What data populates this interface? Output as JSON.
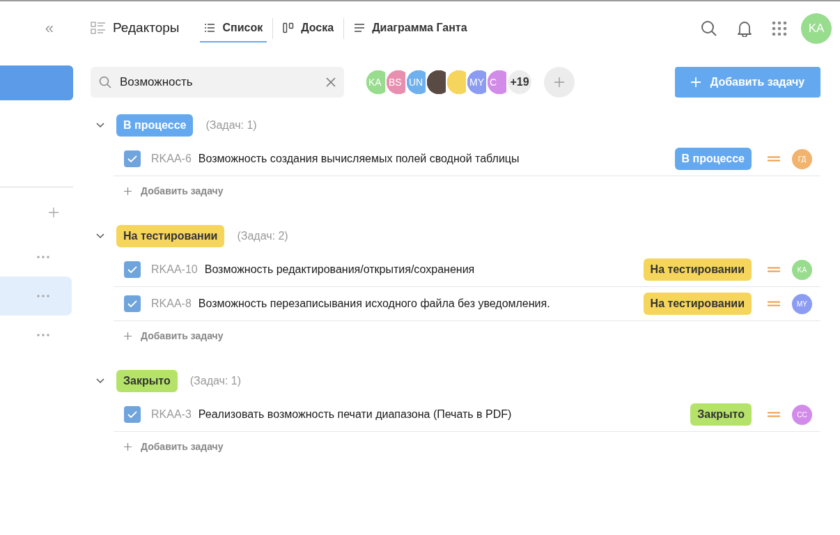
{
  "sidebar": {
    "collapse_glyph": "«",
    "items": [
      {
        "kind": "block",
        "selected": true
      },
      {
        "kind": "plus"
      },
      {
        "kind": "dots",
        "selected": false
      },
      {
        "kind": "dots",
        "selected": true
      },
      {
        "kind": "dots",
        "selected": false
      }
    ]
  },
  "tabs": [
    {
      "label": "Редакторы",
      "selected": false
    },
    {
      "label": "Список",
      "selected": true
    },
    {
      "label": "Доска",
      "selected": false
    },
    {
      "label": "Диаграмма Ганта",
      "selected": false
    }
  ],
  "user": {
    "initials": "KA",
    "color": "#98dc8e"
  },
  "search": {
    "value": "Возможность"
  },
  "members": [
    {
      "initials": "KA",
      "color": "#98dc8e",
      "kind": "initials"
    },
    {
      "initials": "BS",
      "color": "#e88fb0",
      "kind": "initials"
    },
    {
      "initials": "UN",
      "color": "#6fb0ee",
      "kind": "initials"
    },
    {
      "kind": "photo",
      "color": "#5a4a44"
    },
    {
      "color": "#f6d55c",
      "kind": "initials"
    },
    {
      "initials": "MY",
      "color": "#8b9cf2",
      "kind": "initials"
    },
    {
      "initials": "C",
      "color": "#d28be8",
      "kind": "initials"
    },
    {
      "kind": "more",
      "initials": "+19",
      "color": "#ececec"
    }
  ],
  "add_task_button": "Добавить задачу",
  "groups": [
    {
      "status": "В процессе",
      "color": "#64a9ef",
      "count": "(Задач: 1)",
      "expanded": true,
      "add_label": "Добавить задачу",
      "tasks": [
        {
          "id": "RKAA-6",
          "title": "Возможность создания вычисляемых полей сводной таблицы",
          "checked": true,
          "status": {
            "label": "В процессе",
            "color": "#64a9ef"
          },
          "assignee": {
            "initials": "ГД",
            "color": "#f2b36c"
          }
        }
      ]
    },
    {
      "status": "На тестировании",
      "color": "#f6d55c",
      "count": "(Задач: 2)",
      "expanded": true,
      "add_label": "Добавить задачу",
      "tasks": [
        {
          "id": "RKAA-10",
          "title": "Возможность редактирования/открытия/сохранения",
          "checked": true,
          "status": {
            "label": "На тестировании",
            "color": "#f6d55c"
          },
          "assignee": {
            "initials": "KA",
            "color": "#98dc8e"
          }
        },
        {
          "id": "RKAA-8",
          "title": "Возможность перезаписывания исходного файла без уведомления.",
          "checked": true,
          "status": {
            "label": "На тестировании",
            "color": "#f6d55c"
          },
          "assignee": {
            "initials": "MY",
            "color": "#8b9cf2"
          }
        }
      ]
    },
    {
      "status": "Закрыто",
      "color": "#b5e36a",
      "count": "(Задач: 1)",
      "expanded": true,
      "add_label": "Добавить задачу",
      "tasks": [
        {
          "id": "RKAA-3",
          "title": "Реализовать возможность печати диапазона (Печать в PDF)",
          "checked": true,
          "status": {
            "label": "Закрыто",
            "color": "#b5e36a"
          },
          "assignee": {
            "initials": "CC",
            "color": "#d28be8"
          }
        }
      ]
    }
  ]
}
